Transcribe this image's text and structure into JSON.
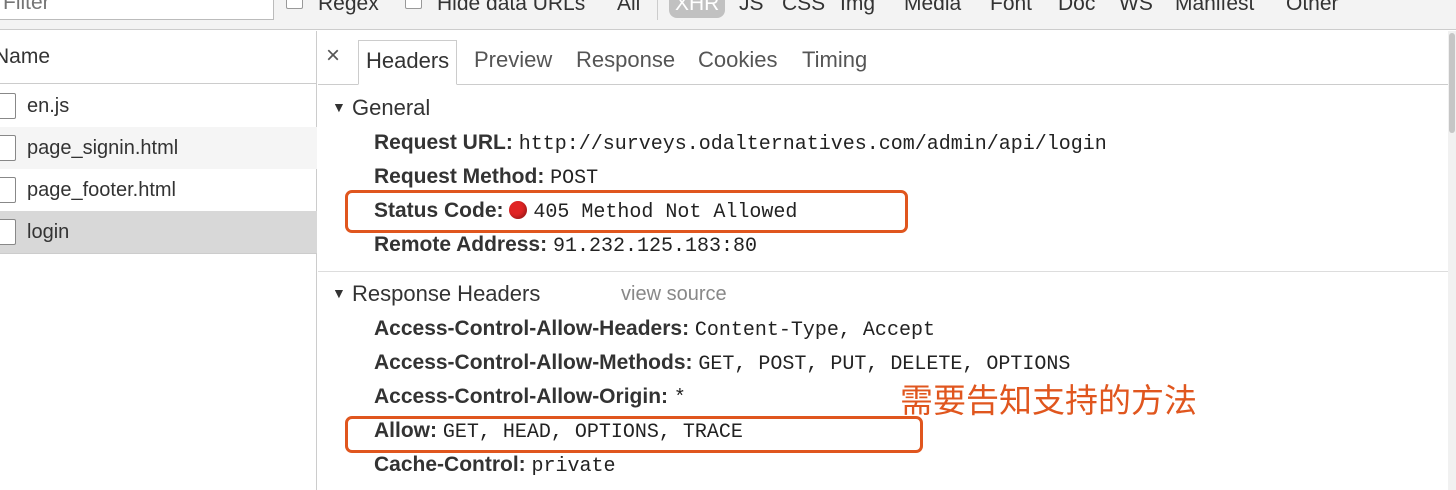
{
  "toolbar": {
    "filter_placeholder": "Filter",
    "regex_label": "Regex",
    "hide_data_urls_label": "Hide data URLs",
    "types": [
      {
        "label": "All",
        "active": false
      },
      {
        "label": "XHR",
        "active": true
      },
      {
        "label": "JS",
        "active": false
      },
      {
        "label": "CSS",
        "active": false
      },
      {
        "label": "Img",
        "active": false
      },
      {
        "label": "Media",
        "active": false
      },
      {
        "label": "Font",
        "active": false
      },
      {
        "label": "Doc",
        "active": false
      },
      {
        "label": "WS",
        "active": false
      },
      {
        "label": "Manifest",
        "active": false
      },
      {
        "label": "Other",
        "active": false
      }
    ]
  },
  "request_list": {
    "column_header": "Name",
    "items": [
      {
        "name": "en.js",
        "selected": false
      },
      {
        "name": "page_signin.html",
        "selected": false
      },
      {
        "name": "page_footer.html",
        "selected": false
      },
      {
        "name": "login",
        "selected": true
      }
    ]
  },
  "details": {
    "close_glyph": "×",
    "tabs": [
      {
        "label": "Headers",
        "active": true
      },
      {
        "label": "Preview",
        "active": false
      },
      {
        "label": "Response",
        "active": false
      },
      {
        "label": "Cookies",
        "active": false
      },
      {
        "label": "Timing",
        "active": false
      }
    ],
    "general": {
      "title": "General",
      "rows": [
        {
          "key": "Request URL:",
          "value": "http://surveys.odalternatives.com/admin/api/login"
        },
        {
          "key": "Request Method:",
          "value": "POST"
        },
        {
          "key": "Status Code:",
          "value": "405 Method Not Allowed"
        },
        {
          "key": "Remote Address:",
          "value": "91.232.125.183:80"
        }
      ]
    },
    "response_headers": {
      "title": "Response Headers",
      "view_source": "view source",
      "rows": [
        {
          "key": "Access-Control-Allow-Headers:",
          "value": "Content-Type, Accept"
        },
        {
          "key": "Access-Control-Allow-Methods:",
          "value": "GET, POST, PUT, DELETE, OPTIONS"
        },
        {
          "key": "Access-Control-Allow-Origin:",
          "value": "*"
        },
        {
          "key": "Allow:",
          "value": "GET, HEAD, OPTIONS, TRACE"
        },
        {
          "key": "Cache-Control:",
          "value": "private"
        }
      ]
    }
  },
  "annotation": {
    "text": "需要告知支持的方法",
    "color": "#e0561e"
  },
  "colors": {
    "status_error": "#e02424",
    "highlight": "#e0561e"
  }
}
